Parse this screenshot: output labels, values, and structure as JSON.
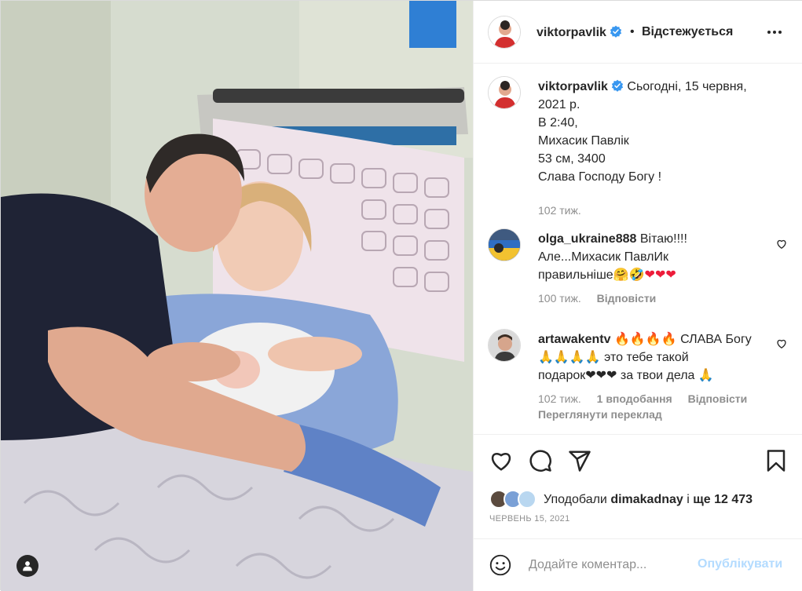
{
  "header": {
    "username": "viktorpavlik",
    "dot": "•",
    "follow_label": "Відстежується"
  },
  "caption": {
    "username": "viktorpavlik",
    "lines": [
      "Сьогодні, 15 червня,",
      "2021 р.",
      "В 2:40,",
      "Михасик Павлік",
      "53 см, 3400",
      "Слава Господу Богу !"
    ],
    "time": "102 тиж."
  },
  "comments": [
    {
      "username": "olga_ukraine888",
      "text_1": "Вітаю!!!!",
      "text_2": "Але...Михасик ПавлИк",
      "text_3": "правильніше",
      "emojis": "🤗🤣❤❤❤",
      "time": "100 тиж.",
      "reply": "Відповісти"
    },
    {
      "username": "artawakentv",
      "text_1": "🔥🔥🔥🔥 СЛАВА Богу",
      "text_2": "🙏🙏🙏🙏 это тебе такой",
      "text_3": "подарок❤❤❤ за твои дела 🙏",
      "time": "102 тиж.",
      "likes": "1 вподобання",
      "reply": "Відповісти",
      "translate": "Переглянути переклад"
    }
  ],
  "likes": {
    "prefix": "Уподобали",
    "user": "dimakadnay",
    "middle": "і",
    "others": "ще 12 473"
  },
  "date": "ЧЕРВЕНЬ 15, 2021",
  "add_comment": {
    "placeholder": "Додайте коментар...",
    "publish_label": "Опублікувати"
  },
  "icons": {
    "verified": "verified-badge-icon",
    "like": "heart-icon",
    "comment": "comment-bubble-icon",
    "share": "paper-plane-icon",
    "save": "bookmark-icon",
    "emoji": "smiley-icon",
    "user_tag": "user-tag-icon"
  },
  "colors": {
    "verified": "#3897f0",
    "publish_disabled": "#b3dbff",
    "meta_gray": "#8e8e8e"
  }
}
